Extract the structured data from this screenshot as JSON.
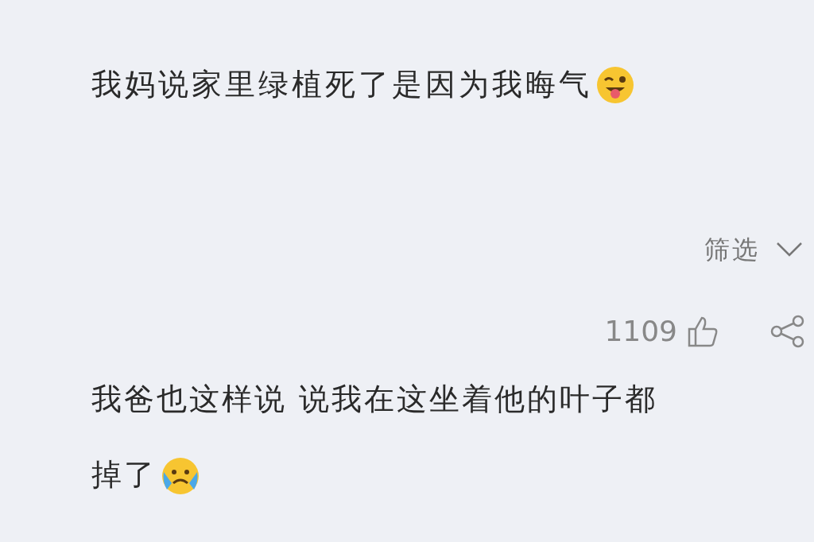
{
  "post": {
    "text": "我妈说家里绿植死了是因为我晦气"
  },
  "filter": {
    "label": "筛选"
  },
  "comments": [
    {
      "likes": "1109",
      "lines": [
        "我爸也这样说 说我在这坐着他的叶子都",
        "掉了"
      ]
    }
  ]
}
